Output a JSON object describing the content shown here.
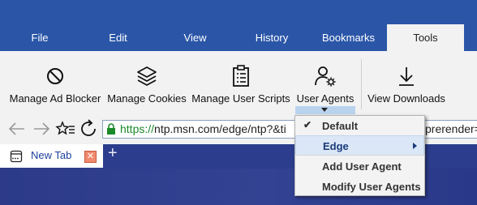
{
  "menubar": {
    "tabs": [
      {
        "label": "File"
      },
      {
        "label": "Edit"
      },
      {
        "label": "View"
      },
      {
        "label": "History"
      },
      {
        "label": "Bookmarks"
      },
      {
        "label": "Tools"
      }
    ],
    "active": "Tools"
  },
  "ribbon": {
    "buttons": [
      {
        "label": "Manage Ad Blocker",
        "icon": "block-icon"
      },
      {
        "label": "Manage Cookies",
        "icon": "cookies-icon"
      },
      {
        "label": "Manage User Scripts",
        "icon": "scripts-icon"
      },
      {
        "label": "User Agents",
        "icon": "user-agent-icon"
      },
      {
        "label": "View Downloads",
        "icon": "download-icon"
      }
    ]
  },
  "address": {
    "scheme": "https://",
    "host": "ntp.msn.com/edge/ntp?&ti",
    "tail": "prerender="
  },
  "tabs": [
    {
      "title": "New Tab"
    }
  ],
  "dropdown": {
    "items": [
      {
        "label": "Default",
        "checked": true
      },
      {
        "label": "Edge",
        "submenu": true
      },
      {
        "label": "Add User Agent"
      },
      {
        "label": "Modify User Agents"
      }
    ]
  },
  "colors": {
    "menubar": "#2b56a8",
    "ribbon": "#f2f2f2",
    "url_green": "#1a8a2a",
    "hover": "#dbe7f6"
  }
}
